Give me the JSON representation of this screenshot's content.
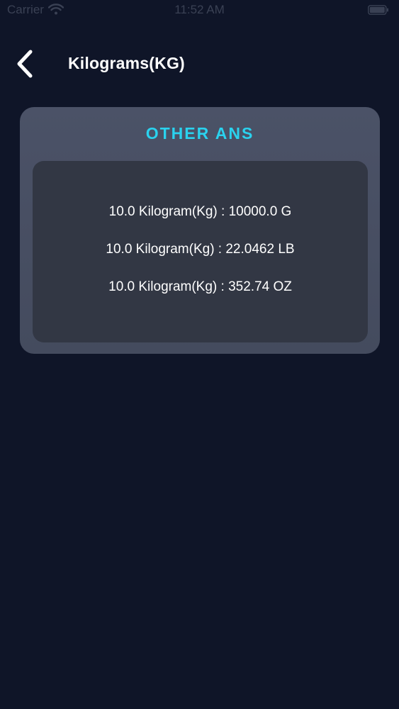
{
  "status_bar": {
    "carrier": "Carrier",
    "time": "11:52 AM",
    "icons": [
      "wifi-icon",
      "battery-icon"
    ]
  },
  "nav": {
    "back_icon": "chevron-left-icon",
    "title": "Kilograms(KG)"
  },
  "card": {
    "title": "OTHER ANS",
    "results": [
      "10.0 Kilogram(Kg) : 10000.0 G",
      "10.0 Kilogram(Kg) : 22.0462 LB",
      "10.0 Kilogram(Kg) : 352.74 OZ"
    ]
  },
  "colors": {
    "background": "#0f1528",
    "card": "#4b5267",
    "inner_panel": "#323744",
    "accent": "#2ad2ee",
    "text": "#ffffff"
  }
}
